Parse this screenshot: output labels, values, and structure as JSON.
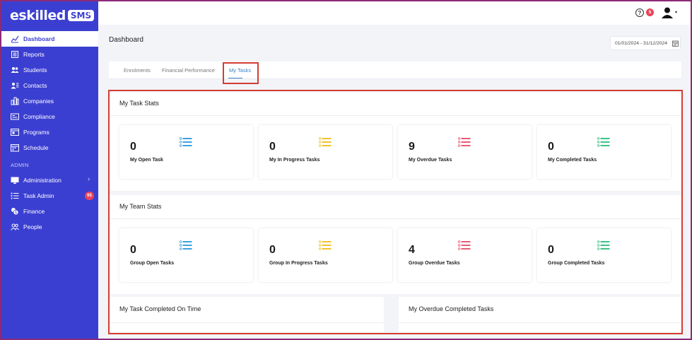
{
  "brand": {
    "name": "eskilled",
    "badge": "SMS",
    "collapse_icon": "double-chevron-left-icon"
  },
  "sidebar": {
    "items": [
      {
        "label": "Dashboard",
        "icon": "chart-line-icon",
        "active": true
      },
      {
        "label": "Reports",
        "icon": "report-icon"
      },
      {
        "label": "Students",
        "icon": "users-icon"
      },
      {
        "label": "Contacts",
        "icon": "contact-icon"
      },
      {
        "label": "Companies",
        "icon": "building-icon"
      },
      {
        "label": "Compliance",
        "icon": "id-card-icon"
      },
      {
        "label": "Programs",
        "icon": "window-icon"
      },
      {
        "label": "Schedule",
        "icon": "calendar-icon"
      }
    ],
    "admin_label": "ADMIN",
    "admin_items": [
      {
        "label": "Administration",
        "icon": "monitor-icon",
        "chevron": "›"
      },
      {
        "label": "Task Admin",
        "icon": "list-icon",
        "badge": "65"
      },
      {
        "label": "Finance",
        "icon": "coins-icon"
      },
      {
        "label": "People",
        "icon": "people-icon"
      }
    ]
  },
  "topbar": {
    "help_label": "?",
    "notification_count": "5",
    "user_caret": "▾"
  },
  "header": {
    "title": "Dashboard",
    "date_range": "01/01/2024 - 31/12/2024"
  },
  "tabs": [
    {
      "label": "Enrolments"
    },
    {
      "label": "Financial Performance"
    },
    {
      "label": "My Tasks",
      "active": true
    }
  ],
  "task_stats": {
    "title": "My Task Stats",
    "cards": [
      {
        "value": "0",
        "label": "My Open Task",
        "icon_color": "#3ba3e0"
      },
      {
        "value": "0",
        "label": "My In Progress Tasks",
        "icon_color": "#f2c230"
      },
      {
        "value": "9",
        "label": "My Overdue Tasks",
        "icon_color": "#e85a78"
      },
      {
        "value": "0",
        "label": "My Completed Tasks",
        "icon_color": "#3cc487"
      }
    ]
  },
  "team_stats": {
    "title": "My Team Stats",
    "cards": [
      {
        "value": "0",
        "label": "Group Open Tasks",
        "icon_color": "#3ba3e0"
      },
      {
        "value": "0",
        "label": "Group In Progress Tasks",
        "icon_color": "#f2c230"
      },
      {
        "value": "4",
        "label": "Group Overdue Tasks",
        "icon_color": "#e85a78"
      },
      {
        "value": "0",
        "label": "Group Completed Tasks",
        "icon_color": "#3cc487"
      }
    ]
  },
  "bottom": {
    "left_title": "My Task Completed On Time",
    "right_title": "My Overdue Completed Tasks"
  },
  "colors": {
    "sidebar_bg": "#3b3fd1",
    "highlight": "#d43c32",
    "tab_active": "#3b82c4",
    "badge": "#e8445a"
  }
}
